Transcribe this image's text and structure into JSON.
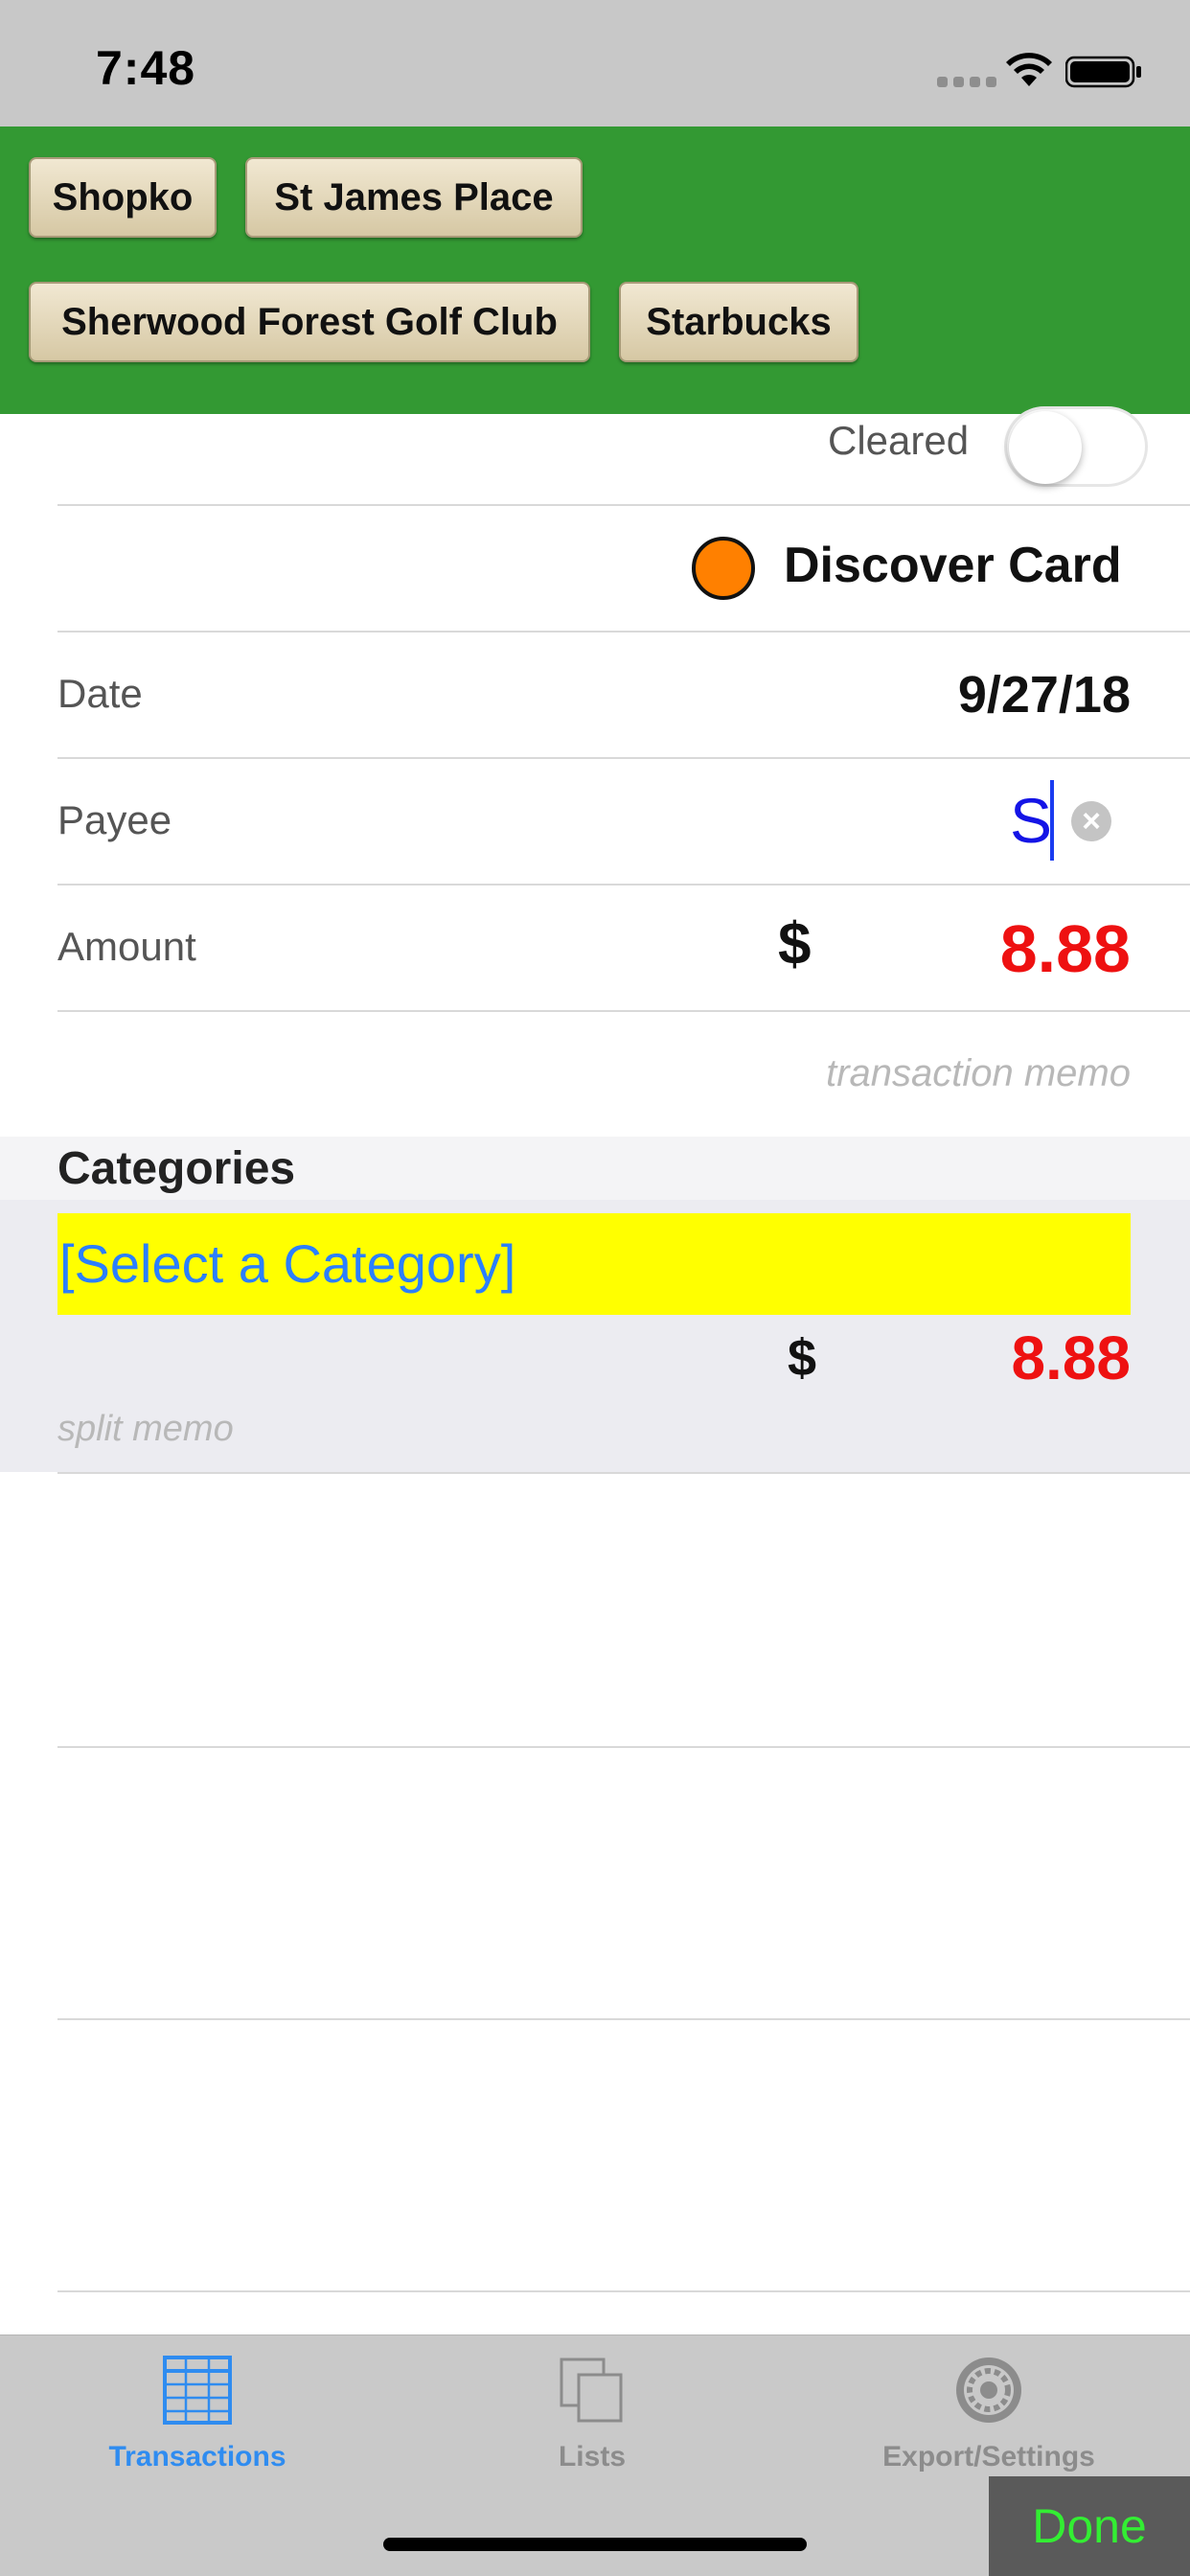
{
  "status_bar": {
    "time": "7:48"
  },
  "suggestions": [
    "Shopko",
    "St James Place",
    "Sherwood Forest Golf Club",
    "Starbucks"
  ],
  "form": {
    "cleared_label": "Cleared",
    "cleared_on": false,
    "account": {
      "name": "Discover Card",
      "color": "#ff8000"
    },
    "date_label": "Date",
    "date_value": "9/27/18",
    "payee_label": "Payee",
    "payee_value": "S",
    "amount_label": "Amount",
    "amount_currency": "$",
    "amount_value": "8.88",
    "memo_placeholder": "transaction memo"
  },
  "categories": {
    "title": "Categories",
    "select_label": "[Select a Category]",
    "split_currency": "$",
    "split_amount": "8.88",
    "split_memo_placeholder": "split memo"
  },
  "tab_bar": {
    "tabs": [
      {
        "label": "Transactions",
        "icon": "table-icon",
        "active": true
      },
      {
        "label": "Lists",
        "icon": "stacked-pages-icon",
        "active": false
      },
      {
        "label": "Export/Settings",
        "icon": "settings-icon",
        "active": false
      }
    ],
    "done_label": "Done"
  },
  "colors": {
    "suggestion_bar": "#339933",
    "amount": "#ee1111",
    "select_highlight": "#ffff00",
    "tab_active": "#2f8cf0",
    "done": "#33ee33"
  }
}
